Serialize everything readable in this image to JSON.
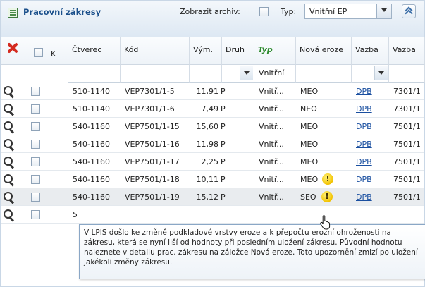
{
  "header": {
    "title": "Pracovní zákresy",
    "archive_label": "Zobrazit archiv:",
    "type_label": "Typ:",
    "type_value": "Vnitřní EP"
  },
  "columns": {
    "k": "K",
    "ctverec": "Čtverec",
    "kod": "Kód",
    "vym": "Vým.",
    "druh": "Druh",
    "typ": "Typ",
    "nova_eroze": "Nová eroze",
    "vazba1": "Vazba",
    "vazba2": "Vazba"
  },
  "filters": {
    "typ": "Vnitřní"
  },
  "rows": [
    {
      "ctverec": "510-1140",
      "kod": "VEP7301/1-5",
      "vym": "11,91",
      "druh": "P",
      "typ": "Vnitř...",
      "eroze": "MEO",
      "warn": false,
      "vazba": "DPB",
      "vazba2": "7301/1"
    },
    {
      "ctverec": "510-1140",
      "kod": "VEP7301/1-6",
      "vym": "7,49",
      "druh": "P",
      "typ": "Vnitř...",
      "eroze": "NEO",
      "warn": false,
      "vazba": "DPB",
      "vazba2": "7301/1"
    },
    {
      "ctverec": "540-1160",
      "kod": "VEP7501/1-15",
      "vym": "15,60",
      "druh": "P",
      "typ": "Vnitř...",
      "eroze": "MEO",
      "warn": false,
      "vazba": "DPB",
      "vazba2": "7501/1"
    },
    {
      "ctverec": "540-1160",
      "kod": "VEP7501/1-16",
      "vym": "11,98",
      "druh": "P",
      "typ": "Vnitř...",
      "eroze": "MEO",
      "warn": false,
      "vazba": "DPB",
      "vazba2": "7501/1"
    },
    {
      "ctverec": "540-1160",
      "kod": "VEP7501/1-17",
      "vym": "2,25",
      "druh": "P",
      "typ": "Vnitř...",
      "eroze": "MEO",
      "warn": false,
      "vazba": "DPB",
      "vazba2": "7501/1"
    },
    {
      "ctverec": "540-1160",
      "kod": "VEP7501/1-18",
      "vym": "10,11",
      "druh": "P",
      "typ": "Vnitř...",
      "eroze": "MEO",
      "warn": true,
      "vazba": "DPB",
      "vazba2": "7501/1"
    },
    {
      "ctverec": "540-1160",
      "kod": "VEP7501/1-19",
      "vym": "15,12",
      "druh": "P",
      "typ": "Vnitř...",
      "eroze": "SEO",
      "warn": true,
      "vazba": "DPB",
      "vazba2": "7501/1"
    },
    {
      "ctverec": "5",
      "kod": "",
      "vym": "",
      "druh": "",
      "typ": "",
      "eroze": "",
      "warn": false,
      "vazba": "",
      "vazba2": ""
    }
  ],
  "tooltip": {
    "text": "V LPIS došlo ke změně podkladové vrstvy eroze a k přepočtu erozní ohroženosti na zákresu, která se nyní liší od hodnoty při posledním uložení zákresu. Původní hodnotu naleznete v detailu prac. zákresu na záložce Nová eroze. Toto upozornění zmizí po uložení jakékoli změny zákresu."
  },
  "colors": {
    "title": "#1a4f8b",
    "typ_header": "#2e8b2e",
    "link": "#1a4fa0",
    "delete": "#d42a1f",
    "warning": "#f2c200"
  }
}
